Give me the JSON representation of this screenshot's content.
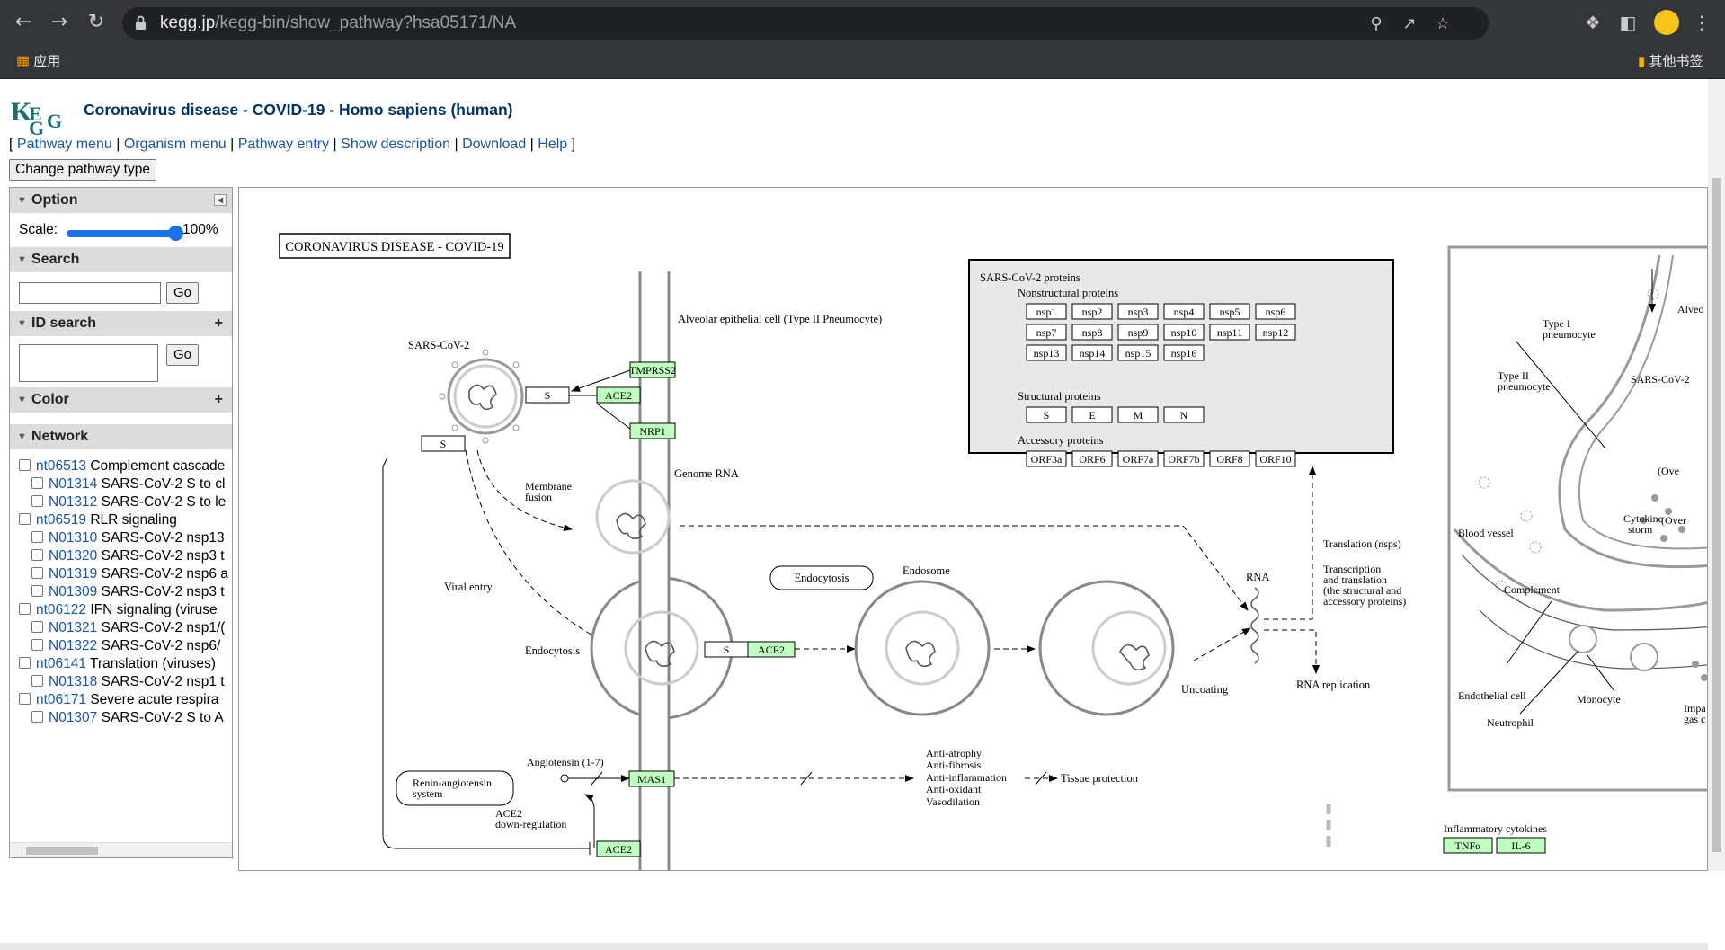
{
  "browser": {
    "url_host": "kegg.jp",
    "url_path": "/kegg-bin/show_pathway?hsa05171/NA",
    "bookmarks": {
      "apps": "应用",
      "other": "其他书签"
    }
  },
  "header": {
    "title": "Coronavirus disease - COVID-19 - Homo sapiens (human)",
    "menu": [
      "Pathway menu",
      "Organism menu",
      "Pathway entry",
      "Show description",
      "Download",
      "Help"
    ],
    "open_bracket": "[",
    "close_bracket": "]",
    "sep": "|",
    "change_type_button": "Change pathway type"
  },
  "panel": {
    "option": {
      "label": "Option",
      "scale_label": "Scale:",
      "scale_value": "100%",
      "scale_fraction": 1.0
    },
    "search": {
      "label": "Search",
      "go": "Go",
      "value": ""
    },
    "id_search": {
      "label": "ID search",
      "go": "Go",
      "value": ""
    },
    "color": {
      "label": "Color"
    },
    "network": {
      "label": "Network",
      "items": [
        {
          "id": "nt06513",
          "text": "Complement cascade",
          "sub": false
        },
        {
          "id": "N01314",
          "text": "SARS-CoV-2 S to cl",
          "sub": true
        },
        {
          "id": "N01312",
          "text": "SARS-CoV-2 S to le",
          "sub": true
        },
        {
          "id": "nt06519",
          "text": "RLR signaling",
          "sub": false
        },
        {
          "id": "N01310",
          "text": "SARS-CoV-2 nsp13",
          "sub": true
        },
        {
          "id": "N01320",
          "text": "SARS-CoV-2 nsp3 t",
          "sub": true
        },
        {
          "id": "N01319",
          "text": "SARS-CoV-2 nsp6 a",
          "sub": true
        },
        {
          "id": "N01309",
          "text": "SARS-CoV-2 nsp3 t",
          "sub": true
        },
        {
          "id": "nt06122",
          "text": "IFN signaling (viruse",
          "sub": false
        },
        {
          "id": "N01321",
          "text": "SARS-CoV-2 nsp1/(",
          "sub": true
        },
        {
          "id": "N01322",
          "text": "SARS-CoV-2 nsp6/",
          "sub": true
        },
        {
          "id": "nt06141",
          "text": "Translation (viruses)",
          "sub": false
        },
        {
          "id": "N01318",
          "text": "SARS-CoV-2 nsp1 t",
          "sub": true
        },
        {
          "id": "nt06171",
          "text": "Severe acute respira",
          "sub": false
        },
        {
          "id": "N01307",
          "text": "SARS-CoV-2 S to A",
          "sub": true
        }
      ]
    }
  },
  "map": {
    "title": "CORONAVIRUS DISEASE - COVID-19",
    "proteins_box": {
      "title": "SARS-CoV-2 proteins",
      "nonstructural_label": "Nonstructural proteins",
      "nonstructural": [
        "nsp1",
        "nsp2",
        "nsp3",
        "nsp4",
        "nsp5",
        "nsp6",
        "nsp7",
        "nsp8",
        "nsp9",
        "nsp10",
        "nsp11",
        "nsp12",
        "nsp13",
        "nsp14",
        "nsp15",
        "nsp16"
      ],
      "structural_label": "Structural proteins",
      "structural": [
        "S",
        "E",
        "M",
        "N"
      ],
      "accessory_label": "Accessory proteins",
      "accessory": [
        "ORF3a",
        "ORF6",
        "ORF7a",
        "ORF7b",
        "ORF8",
        "ORF10"
      ]
    },
    "labels": {
      "sars_cov_2": "SARS-CoV-2",
      "alveolar": "Alveolar epithelial cell (Type II Pneumocyte)",
      "tmprss2": "TMPRSS2",
      "ace2": "ACE2",
      "nrp1": "NRP1",
      "s": "S",
      "membrane_fusion_1": "Membrane",
      "membrane_fusion_2": "fusion",
      "genome_rna": "Genome RNA",
      "viral_entry": "Viral entry",
      "endocytosis": "Endocytosis",
      "endocytosis_box": "Endocytosis",
      "endosome": "Endosome",
      "uncoating": "Uncoating",
      "rna": "RNA",
      "translation": "Translation (nsps)",
      "transcription_1": "Transcription",
      "transcription_2": "and translation",
      "transcription_3": "(the structural and",
      "transcription_4": "accessory proteins)",
      "rna_replication": "RNA replication",
      "angiotensin": "Angiotensin (1-7)",
      "mas1": "MAS1",
      "renin_1": "Renin-angiotensin",
      "renin_2": "system",
      "ace2_down_1": "ACE2",
      "ace2_down_2": "down-regulation",
      "effects": [
        "Anti-atrophy",
        "Anti-fibrosis",
        "Anti-inflammation",
        "Anti-oxidant",
        "Vasodilation"
      ],
      "tissue_protection": "Tissue protection",
      "type1_1": "Type I",
      "type1_2": "pneumocyte",
      "type2_1": "Type II",
      "type2_2": "pneumocyte",
      "alveo": "Alveo",
      "sars_right": "SARS-CoV-2",
      "ove1": "(Ove",
      "ove2": "(Over",
      "cytokine_1": "Cytokine",
      "cytokine_2": "storm",
      "blood_vessel": "Blood vessel",
      "complement": "Complement",
      "endothelial": "Endothelial cell",
      "monocyte": "Monocyte",
      "neutrophil": "Neutrophil",
      "impa_1": "Impa",
      "impa_2": "gas c",
      "inflammatory": "Inflammatory cytokines",
      "tnfa": "TNFα",
      "il6": "IL-6"
    }
  },
  "colors": {
    "gene_fill": "#bfffbf",
    "link": "#1a55a3",
    "title": "#003366"
  }
}
